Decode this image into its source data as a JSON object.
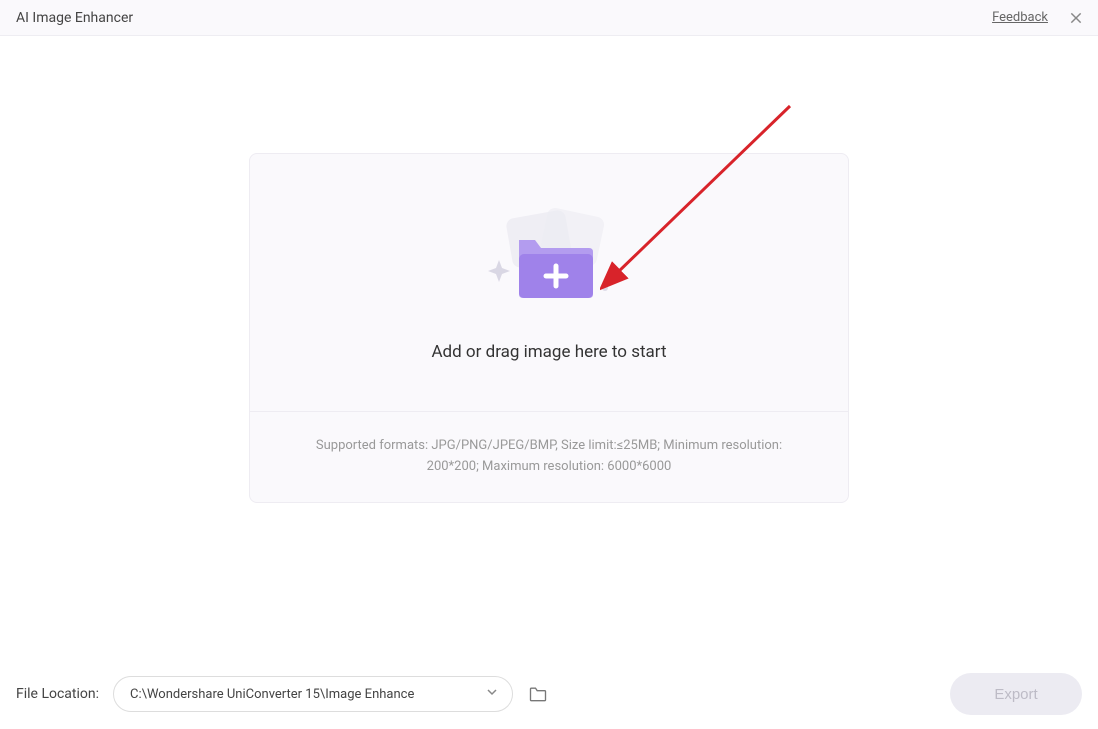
{
  "header": {
    "title": "AI Image Enhancer",
    "feedback_label": "Feedback"
  },
  "dropzone": {
    "main_text": "Add or drag image here to start",
    "info_text": "Supported formats: JPG/PNG/JPEG/BMP, Size limit:≤25MB; Minimum resolution: 200*200; Maximum resolution: 6000*6000"
  },
  "footer": {
    "location_label": "File Location:",
    "path_value": "C:\\Wondershare UniConverter 15\\Image Enhance",
    "export_label": "Export"
  }
}
